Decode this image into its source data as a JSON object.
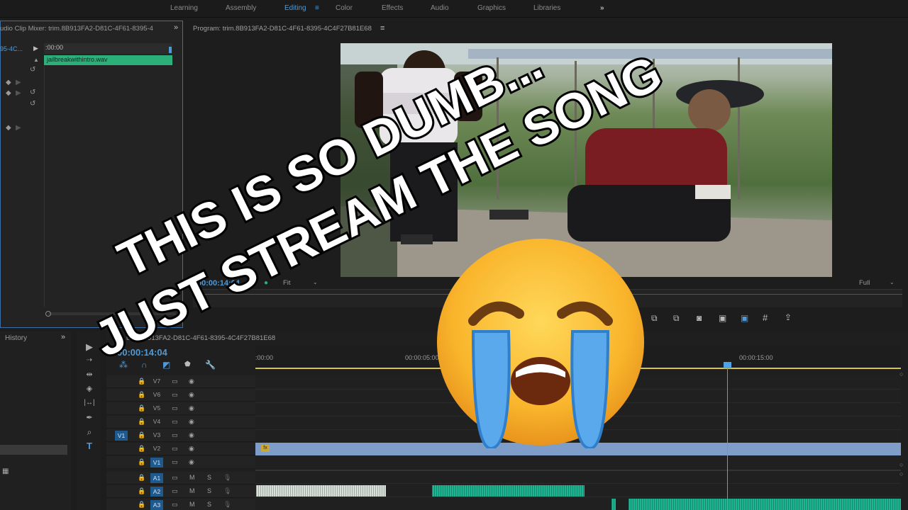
{
  "workspaces": {
    "tabs": [
      "Learning",
      "Assembly",
      "Editing",
      "Color",
      "Effects",
      "Audio",
      "Graphics",
      "Libraries"
    ],
    "active": "Editing",
    "more_glyph": "»"
  },
  "source_panel": {
    "title": "udio Clip Mixer: trim.8B913FA2-D81C-4F61-8395-4",
    "clip_name_short": "95-4C...",
    "ruler_time": ":00:00",
    "clip_label": "jailbreakwithintro.wav"
  },
  "program": {
    "title": "Program: trim.8B913FA2-D81C-4F61-8395-4C4F27B81E68",
    "timecode": "00:00:14:04",
    "fit_label": "Fit",
    "quality_label": "Full"
  },
  "history": {
    "title": "History"
  },
  "timeline": {
    "title": "trim.8B913FA2-D81C-4F61-8395-4C4F27B81E68",
    "timecode": "00:00:14:04",
    "ruler_labels": [
      ":00:00",
      "00:00:05:00",
      "00:00:15:00"
    ],
    "video_tracks": [
      "V7",
      "V6",
      "V5",
      "V4",
      "V3",
      "V2",
      "V1"
    ],
    "audio_tracks": [
      "A1",
      "A2",
      "A3"
    ],
    "source_patch": "V1",
    "mute_label": "M",
    "solo_label": "S",
    "fx_badge": "fx"
  },
  "overlay": {
    "line1": "THIS IS SO DUMB...",
    "line2": "JUST STREAM THE SONG"
  },
  "colors": {
    "accent": "#4e9ad8",
    "audio_clip": "#1fb592",
    "video_clip": "#7f9dc9",
    "ruler_work_area": "#d8c44a"
  }
}
